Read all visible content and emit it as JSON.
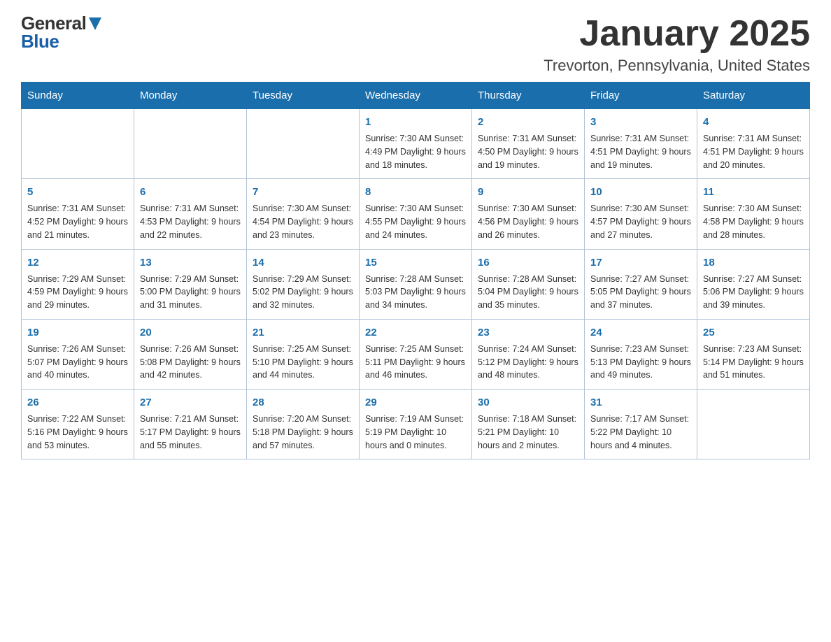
{
  "header": {
    "logo": {
      "general": "General",
      "arrow": "▶",
      "blue": "Blue"
    },
    "title": "January 2025",
    "location": "Trevorton, Pennsylvania, United States"
  },
  "calendar": {
    "days_of_week": [
      "Sunday",
      "Monday",
      "Tuesday",
      "Wednesday",
      "Thursday",
      "Friday",
      "Saturday"
    ],
    "weeks": [
      [
        {
          "day": "",
          "info": ""
        },
        {
          "day": "",
          "info": ""
        },
        {
          "day": "",
          "info": ""
        },
        {
          "day": "1",
          "info": "Sunrise: 7:30 AM\nSunset: 4:49 PM\nDaylight: 9 hours\nand 18 minutes."
        },
        {
          "day": "2",
          "info": "Sunrise: 7:31 AM\nSunset: 4:50 PM\nDaylight: 9 hours\nand 19 minutes."
        },
        {
          "day": "3",
          "info": "Sunrise: 7:31 AM\nSunset: 4:51 PM\nDaylight: 9 hours\nand 19 minutes."
        },
        {
          "day": "4",
          "info": "Sunrise: 7:31 AM\nSunset: 4:51 PM\nDaylight: 9 hours\nand 20 minutes."
        }
      ],
      [
        {
          "day": "5",
          "info": "Sunrise: 7:31 AM\nSunset: 4:52 PM\nDaylight: 9 hours\nand 21 minutes."
        },
        {
          "day": "6",
          "info": "Sunrise: 7:31 AM\nSunset: 4:53 PM\nDaylight: 9 hours\nand 22 minutes."
        },
        {
          "day": "7",
          "info": "Sunrise: 7:30 AM\nSunset: 4:54 PM\nDaylight: 9 hours\nand 23 minutes."
        },
        {
          "day": "8",
          "info": "Sunrise: 7:30 AM\nSunset: 4:55 PM\nDaylight: 9 hours\nand 24 minutes."
        },
        {
          "day": "9",
          "info": "Sunrise: 7:30 AM\nSunset: 4:56 PM\nDaylight: 9 hours\nand 26 minutes."
        },
        {
          "day": "10",
          "info": "Sunrise: 7:30 AM\nSunset: 4:57 PM\nDaylight: 9 hours\nand 27 minutes."
        },
        {
          "day": "11",
          "info": "Sunrise: 7:30 AM\nSunset: 4:58 PM\nDaylight: 9 hours\nand 28 minutes."
        }
      ],
      [
        {
          "day": "12",
          "info": "Sunrise: 7:29 AM\nSunset: 4:59 PM\nDaylight: 9 hours\nand 29 minutes."
        },
        {
          "day": "13",
          "info": "Sunrise: 7:29 AM\nSunset: 5:00 PM\nDaylight: 9 hours\nand 31 minutes."
        },
        {
          "day": "14",
          "info": "Sunrise: 7:29 AM\nSunset: 5:02 PM\nDaylight: 9 hours\nand 32 minutes."
        },
        {
          "day": "15",
          "info": "Sunrise: 7:28 AM\nSunset: 5:03 PM\nDaylight: 9 hours\nand 34 minutes."
        },
        {
          "day": "16",
          "info": "Sunrise: 7:28 AM\nSunset: 5:04 PM\nDaylight: 9 hours\nand 35 minutes."
        },
        {
          "day": "17",
          "info": "Sunrise: 7:27 AM\nSunset: 5:05 PM\nDaylight: 9 hours\nand 37 minutes."
        },
        {
          "day": "18",
          "info": "Sunrise: 7:27 AM\nSunset: 5:06 PM\nDaylight: 9 hours\nand 39 minutes."
        }
      ],
      [
        {
          "day": "19",
          "info": "Sunrise: 7:26 AM\nSunset: 5:07 PM\nDaylight: 9 hours\nand 40 minutes."
        },
        {
          "day": "20",
          "info": "Sunrise: 7:26 AM\nSunset: 5:08 PM\nDaylight: 9 hours\nand 42 minutes."
        },
        {
          "day": "21",
          "info": "Sunrise: 7:25 AM\nSunset: 5:10 PM\nDaylight: 9 hours\nand 44 minutes."
        },
        {
          "day": "22",
          "info": "Sunrise: 7:25 AM\nSunset: 5:11 PM\nDaylight: 9 hours\nand 46 minutes."
        },
        {
          "day": "23",
          "info": "Sunrise: 7:24 AM\nSunset: 5:12 PM\nDaylight: 9 hours\nand 48 minutes."
        },
        {
          "day": "24",
          "info": "Sunrise: 7:23 AM\nSunset: 5:13 PM\nDaylight: 9 hours\nand 49 minutes."
        },
        {
          "day": "25",
          "info": "Sunrise: 7:23 AM\nSunset: 5:14 PM\nDaylight: 9 hours\nand 51 minutes."
        }
      ],
      [
        {
          "day": "26",
          "info": "Sunrise: 7:22 AM\nSunset: 5:16 PM\nDaylight: 9 hours\nand 53 minutes."
        },
        {
          "day": "27",
          "info": "Sunrise: 7:21 AM\nSunset: 5:17 PM\nDaylight: 9 hours\nand 55 minutes."
        },
        {
          "day": "28",
          "info": "Sunrise: 7:20 AM\nSunset: 5:18 PM\nDaylight: 9 hours\nand 57 minutes."
        },
        {
          "day": "29",
          "info": "Sunrise: 7:19 AM\nSunset: 5:19 PM\nDaylight: 10 hours\nand 0 minutes."
        },
        {
          "day": "30",
          "info": "Sunrise: 7:18 AM\nSunset: 5:21 PM\nDaylight: 10 hours\nand 2 minutes."
        },
        {
          "day": "31",
          "info": "Sunrise: 7:17 AM\nSunset: 5:22 PM\nDaylight: 10 hours\nand 4 minutes."
        },
        {
          "day": "",
          "info": ""
        }
      ]
    ]
  }
}
